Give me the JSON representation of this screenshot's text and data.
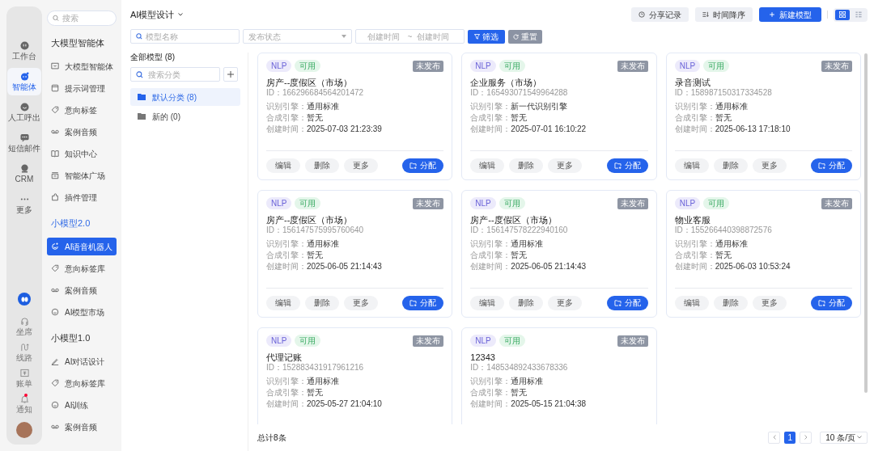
{
  "rail": {
    "top": [
      {
        "label": "工作台",
        "selected": false
      },
      {
        "label": "智能体",
        "selected": true
      },
      {
        "label": "人工呼出",
        "selected": false
      },
      {
        "label": "短信邮件",
        "selected": false
      },
      {
        "label": "CRM",
        "selected": false
      },
      {
        "label": "更多",
        "selected": false
      }
    ],
    "bottom": [
      {
        "label": "坐席",
        "badge": false
      },
      {
        "label": "线路",
        "badge": false
      },
      {
        "label": "账单",
        "badge": false
      },
      {
        "label": "通知",
        "badge": true
      }
    ]
  },
  "sidebar": {
    "search_placeholder": "搜索",
    "sections": [
      {
        "title": "大模型智能体",
        "accent": false,
        "items": [
          {
            "label": "大模型智能体",
            "selected": false
          },
          {
            "label": "提示词管理",
            "selected": false
          },
          {
            "label": "意向标签",
            "selected": false
          },
          {
            "label": "案例音频",
            "selected": false
          },
          {
            "label": "知识中心",
            "selected": false
          },
          {
            "label": "智能体广场",
            "selected": false
          },
          {
            "label": "插件管理",
            "selected": false
          }
        ]
      },
      {
        "title": "小模型2.0",
        "accent": true,
        "items": [
          {
            "label": "AI语音机器人",
            "selected": true
          },
          {
            "label": "意向标签库",
            "selected": false
          },
          {
            "label": "案例音频",
            "selected": false
          },
          {
            "label": "AI模型市场",
            "selected": false
          }
        ]
      },
      {
        "title": "小模型1.0",
        "accent": false,
        "items": [
          {
            "label": "AI对话设计",
            "selected": false
          },
          {
            "label": "意向标签库",
            "selected": false
          },
          {
            "label": "AI训练",
            "selected": false
          },
          {
            "label": "案例音频",
            "selected": false
          }
        ]
      }
    ]
  },
  "header": {
    "title": "AI模型设计",
    "actions": [
      {
        "label": "分享记录",
        "kind": "history",
        "primary": false
      },
      {
        "label": "时间降序",
        "kind": "sort",
        "primary": false
      },
      {
        "label": "新建模型",
        "kind": "add",
        "primary": true
      }
    ],
    "views": [
      {
        "kind": "grid",
        "selected": true
      },
      {
        "kind": "list",
        "selected": false
      }
    ]
  },
  "filters": {
    "name_placeholder": "模型名称",
    "status_placeholder": "发布状态",
    "date_start_placeholder": "创建时间",
    "date_separator": "~",
    "date_end_placeholder": "创建时间",
    "filter_button": "筛选",
    "reset_button": "重置"
  },
  "categories": {
    "title": "全部模型 (8)",
    "search_placeholder": "搜索分类",
    "items": [
      {
        "label": "默认分类 (8)",
        "selected": true
      },
      {
        "label": "新的 (0)",
        "selected": false
      }
    ]
  },
  "cards": [
    {
      "tags": [
        "NLP",
        "可用"
      ],
      "status": "未发布",
      "name": "房产--度假区（市场）",
      "id": "ID：166296684564201472",
      "fields": [
        [
          "识别引擎：",
          "通用标准"
        ],
        [
          "合成引擎：",
          "暂无"
        ],
        [
          "创建时间：",
          "2025-07-03 21:23:39"
        ]
      ],
      "buttons": [
        "编辑",
        "删除",
        "更多"
      ],
      "assign": "分配"
    },
    {
      "tags": [
        "NLP",
        "可用"
      ],
      "status": "未发布",
      "name": "企业服务（市场）",
      "id": "ID：165493071549964288",
      "fields": [
        [
          "识别引擎：",
          "新一代识别引擎"
        ],
        [
          "合成引擎：",
          "暂无"
        ],
        [
          "创建时间：",
          "2025-07-01 16:10:22"
        ]
      ],
      "buttons": [
        "编辑",
        "删除",
        "更多"
      ],
      "assign": "分配"
    },
    {
      "tags": [
        "NLP",
        "可用"
      ],
      "status": "未发布",
      "name": "录音测试",
      "id": "ID：158987150317334528",
      "fields": [
        [
          "识别引擎：",
          "通用标准"
        ],
        [
          "合成引擎：",
          "暂无"
        ],
        [
          "创建时间：",
          "2025-06-13 17:18:10"
        ]
      ],
      "buttons": [
        "编辑",
        "删除",
        "更多"
      ],
      "assign": "分配"
    },
    {
      "tags": [
        "NLP",
        "可用"
      ],
      "status": "未发布",
      "name": "房产--度假区（市场）",
      "id": "ID：156147575995760640",
      "fields": [
        [
          "识别引擎：",
          "通用标准"
        ],
        [
          "合成引擎：",
          "暂无"
        ],
        [
          "创建时间：",
          "2025-06-05 21:14:43"
        ]
      ],
      "buttons": [
        "编辑",
        "删除",
        "更多"
      ],
      "assign": "分配"
    },
    {
      "tags": [
        "NLP",
        "可用"
      ],
      "status": "未发布",
      "name": "房产--度假区（市场）",
      "id": "ID：156147578222940160",
      "fields": [
        [
          "识别引擎：",
          "通用标准"
        ],
        [
          "合成引擎：",
          "暂无"
        ],
        [
          "创建时间：",
          "2025-06-05 21:14:43"
        ]
      ],
      "buttons": [
        "编辑",
        "删除",
        "更多"
      ],
      "assign": "分配"
    },
    {
      "tags": [
        "NLP",
        "可用"
      ],
      "status": "未发布",
      "name": "物业客服",
      "id": "ID：155266440398872576",
      "fields": [
        [
          "识别引擎：",
          "通用标准"
        ],
        [
          "合成引擎：",
          "暂无"
        ],
        [
          "创建时间：",
          "2025-06-03 10:53:24"
        ]
      ],
      "buttons": [
        "编辑",
        "删除",
        "更多"
      ],
      "assign": "分配"
    },
    {
      "tags": [
        "NLP",
        "可用"
      ],
      "status": "未发布",
      "name": "代理记账",
      "id": "ID：152883431917961216",
      "fields": [
        [
          "识别引擎：",
          "通用标准"
        ],
        [
          "合成引擎：",
          "暂无"
        ],
        [
          "创建时间：",
          "2025-05-27 21:04:10"
        ]
      ]
    },
    {
      "tags": [
        "NLP",
        "可用"
      ],
      "status": "未发布",
      "name": "12343",
      "id": "ID：148534892433678336",
      "fields": [
        [
          "识别引擎：",
          "通用标准"
        ],
        [
          "合成引擎：",
          "暂无"
        ],
        [
          "创建时间：",
          "2025-05-15 21:04:38"
        ]
      ]
    }
  ],
  "footer": {
    "total": "总计8条",
    "pages": [
      {
        "label": "1",
        "selected": true
      }
    ],
    "page_size": "10 条/页"
  }
}
